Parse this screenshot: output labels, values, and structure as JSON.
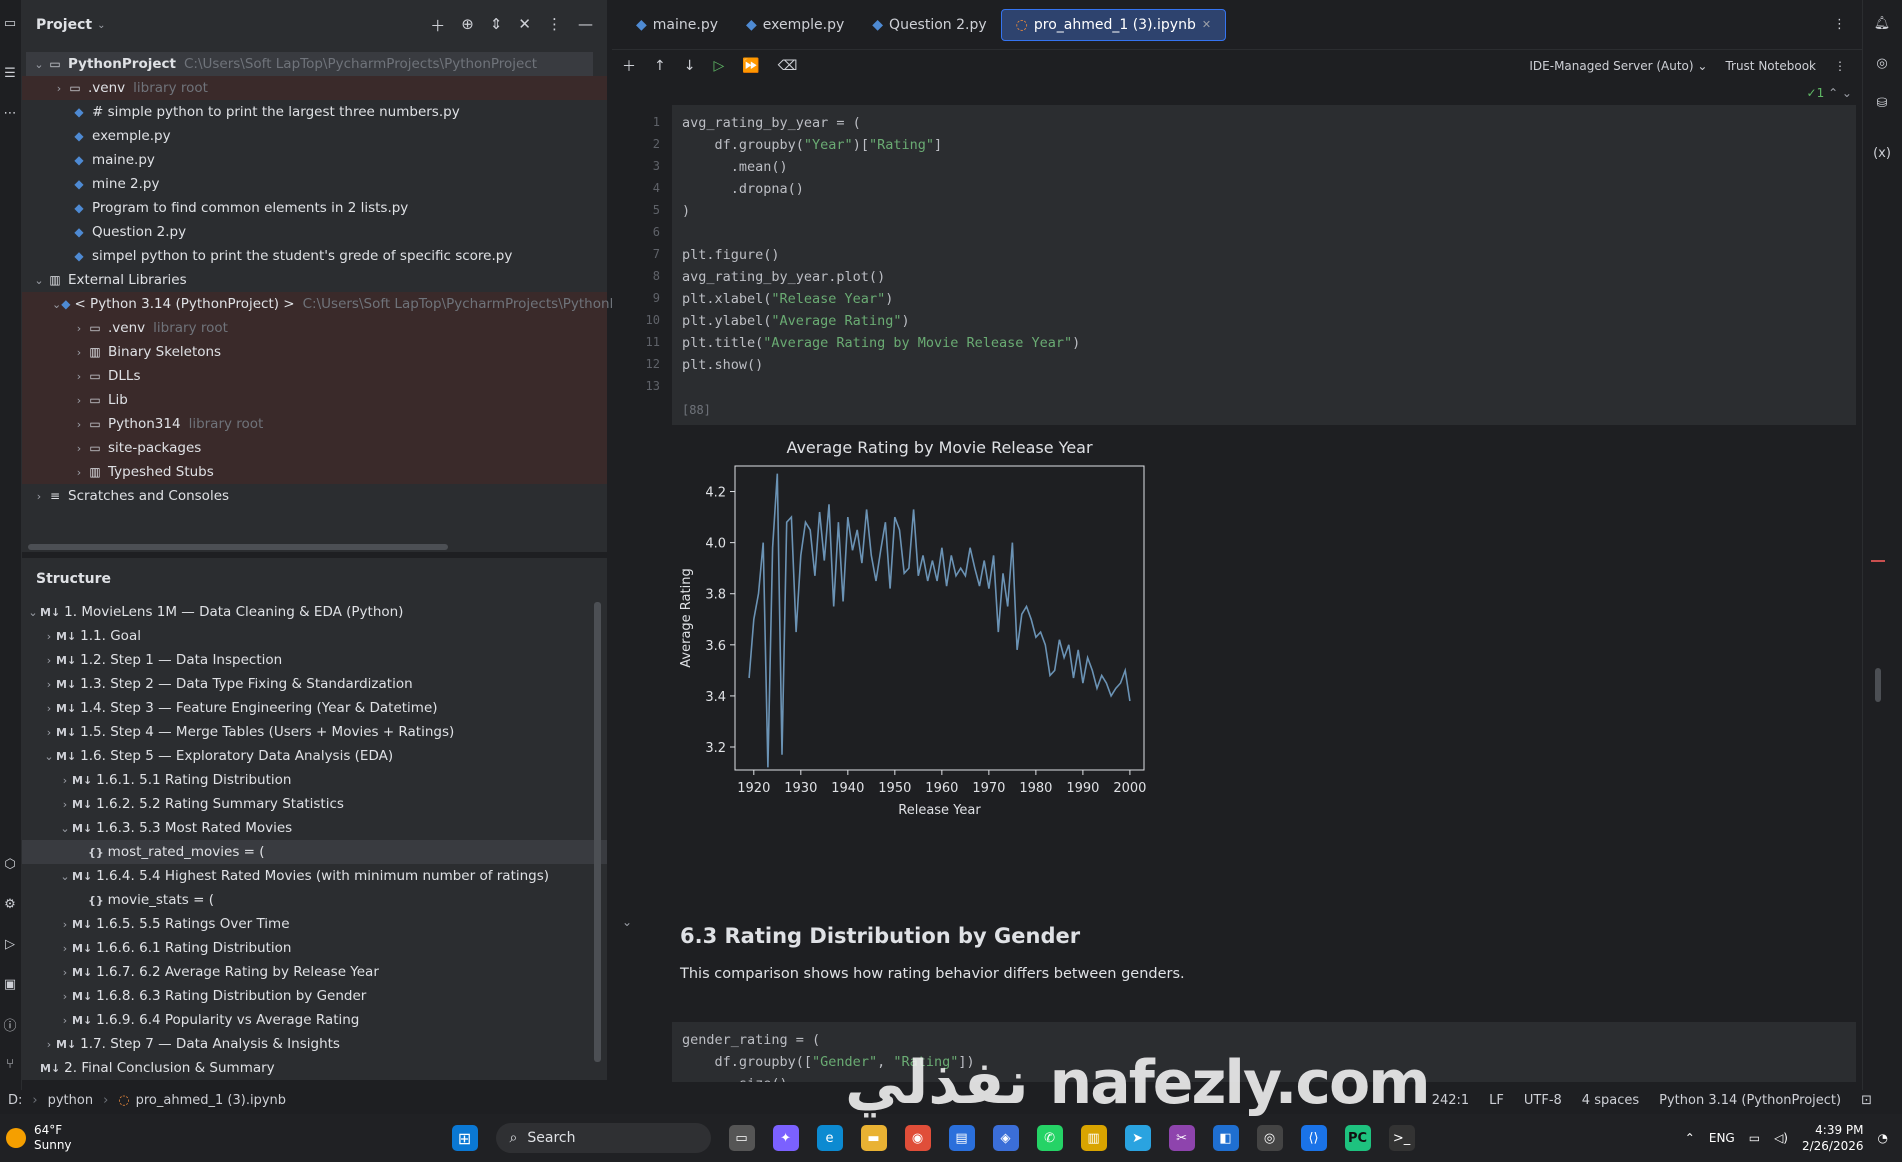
{
  "project": {
    "title": "Project",
    "root_name": "PythonProject",
    "root_path": "C:\\Users\\Soft LapTop\\PycharmProjects\\PythonProject",
    "venv_name": ".venv",
    "library_root_hint": "library root",
    "files": [
      "# simple python to print the largest three numbers.py",
      "exemple.py",
      "maine.py",
      "mine 2.py",
      "Program to find common elements in 2 lists.py",
      "Question 2.py",
      "simpel python to print the student's grede of specific score.py"
    ],
    "external_libraries": "External Libraries",
    "interpreter": "< Python 3.14 (PythonProject) >",
    "interpreter_path": "C:\\Users\\Soft LapTop\\PycharmProjects\\PythonP",
    "lib_children": [
      ".venv",
      "Binary Skeletons",
      "DLLs",
      "Lib",
      "Python314",
      "site-packages",
      "Typeshed Stubs"
    ],
    "scratches": "Scratches and Consoles"
  },
  "structure": {
    "title": "Structure",
    "items": [
      "1. MovieLens 1M — Data Cleaning & EDA (Python)",
      "1.1. Goal",
      "1.2. Step 1 — Data Inspection",
      "1.3. Step 2 — Data Type Fixing & Standardization",
      "1.4. Step 3 — Feature Engineering (Year & Datetime)",
      "1.5. Step 4 — Merge Tables (Users + Movies + Ratings)",
      "1.6. Step 5 — Exploratory Data Analysis (EDA)",
      "1.6.1. 5.1 Rating Distribution",
      "1.6.2. 5.2 Rating Summary Statistics",
      "1.6.3. 5.3 Most Rated Movies",
      "most_rated_movies = (",
      "1.6.4. 5.4 Highest Rated Movies (with minimum number of ratings)",
      "movie_stats = (",
      "1.6.5. 5.5 Ratings Over Time",
      "1.6.6. 6.1 Rating Distribution",
      "1.6.7. 6.2 Average Rating by Release Year",
      "1.6.8. 6.3 Rating Distribution by Gender",
      "1.6.9. 6.4 Popularity vs Average Rating",
      "1.7. Step 7 — Data Analysis & Insights",
      "2. Final Conclusion & Summary"
    ]
  },
  "tabs": [
    "maine.py",
    "exemple.py",
    "Question 2.py",
    "pro_ahmed_1 (3).ipynb"
  ],
  "toolbar": {
    "server": "IDE-Managed Server (Auto)",
    "trust": "Trust Notebook",
    "inspections": "1"
  },
  "cell1": {
    "lines": [
      "avg_rating_by_year = (",
      "    df.groupby(\"Year\")[\"Rating\"]",
      "      .mean()",
      "      .dropna()",
      ")",
      "",
      "plt.figure()",
      "avg_rating_by_year.plot()",
      "plt.xlabel(\"Release Year\")",
      "plt.ylabel(\"Average Rating\")",
      "plt.title(\"Average Rating by Movie Release Year\")",
      "plt.show()",
      ""
    ],
    "exec_count": "[88]"
  },
  "chart_data": {
    "type": "line",
    "title": "Average Rating by Movie Release Year",
    "xlabel": "Release Year",
    "ylabel": "Average Rating",
    "xlim": [
      1916,
      2003
    ],
    "ylim": [
      3.11,
      4.3
    ],
    "xticks": [
      1920,
      1930,
      1940,
      1950,
      1960,
      1970,
      1980,
      1990,
      2000
    ],
    "yticks": [
      3.2,
      3.4,
      3.6,
      3.8,
      4.0,
      4.2
    ],
    "series": [
      {
        "x": [
          1919,
          1920,
          1921,
          1922,
          1923,
          1924,
          1925,
          1926,
          1927,
          1928,
          1929,
          1930,
          1931,
          1932,
          1933,
          1934,
          1935,
          1936,
          1937,
          1938,
          1939,
          1940,
          1941,
          1942,
          1943,
          1944,
          1945,
          1946,
          1947,
          1948,
          1949,
          1950,
          1951,
          1952,
          1953,
          1954,
          1955,
          1956,
          1957,
          1958,
          1959,
          1960,
          1961,
          1962,
          1963,
          1964,
          1965,
          1966,
          1967,
          1968,
          1969,
          1970,
          1971,
          1972,
          1973,
          1974,
          1975,
          1976,
          1977,
          1978,
          1979,
          1980,
          1981,
          1982,
          1983,
          1984,
          1985,
          1986,
          1987,
          1988,
          1989,
          1990,
          1991,
          1992,
          1993,
          1994,
          1995,
          1996,
          1997,
          1998,
          1999,
          2000
        ],
        "values": [
          3.47,
          3.7,
          3.8,
          4.0,
          3.12,
          3.98,
          4.27,
          3.17,
          4.08,
          4.1,
          3.65,
          3.95,
          4.08,
          4.05,
          3.87,
          4.12,
          3.93,
          4.15,
          3.75,
          4.08,
          3.77,
          4.1,
          3.97,
          4.05,
          3.92,
          4.13,
          3.95,
          3.85,
          3.97,
          4.08,
          3.82,
          4.1,
          4.05,
          3.88,
          3.9,
          4.13,
          3.87,
          3.95,
          3.85,
          3.93,
          3.85,
          3.98,
          3.83,
          3.95,
          3.87,
          3.9,
          3.87,
          3.98,
          3.9,
          3.83,
          3.93,
          3.82,
          3.95,
          3.65,
          3.88,
          3.75,
          4.0,
          3.58,
          3.72,
          3.75,
          3.7,
          3.63,
          3.65,
          3.6,
          3.48,
          3.5,
          3.62,
          3.55,
          3.6,
          3.47,
          3.58,
          3.45,
          3.55,
          3.5,
          3.43,
          3.48,
          3.45,
          3.4,
          3.43,
          3.45,
          3.5,
          3.38
        ]
      }
    ]
  },
  "md": {
    "heading": "6.3 Rating Distribution by Gender",
    "body": "This comparison shows how rating behavior differs between genders."
  },
  "cell2": {
    "lines": [
      "gender_rating = (",
      "    df.groupby([\"Gender\", \"Rating\"])",
      "      .size()"
    ]
  },
  "status": {
    "drive": "D:",
    "crumb1": "python",
    "crumb2": "pro_ahmed_1 (3).ipynb",
    "position": "242:1",
    "line_sep": "LF",
    "encoding": "UTF-8",
    "indent": "4 spaces",
    "interpreter": "Python 3.14 (PythonProject)"
  },
  "taskbar": {
    "temp": "64°F",
    "weather": "Sunny",
    "search": "Search",
    "lang": "ENG",
    "time": "4:39 PM",
    "date": "2/26/2026"
  },
  "watermark": "نفذلي nafezly.com"
}
